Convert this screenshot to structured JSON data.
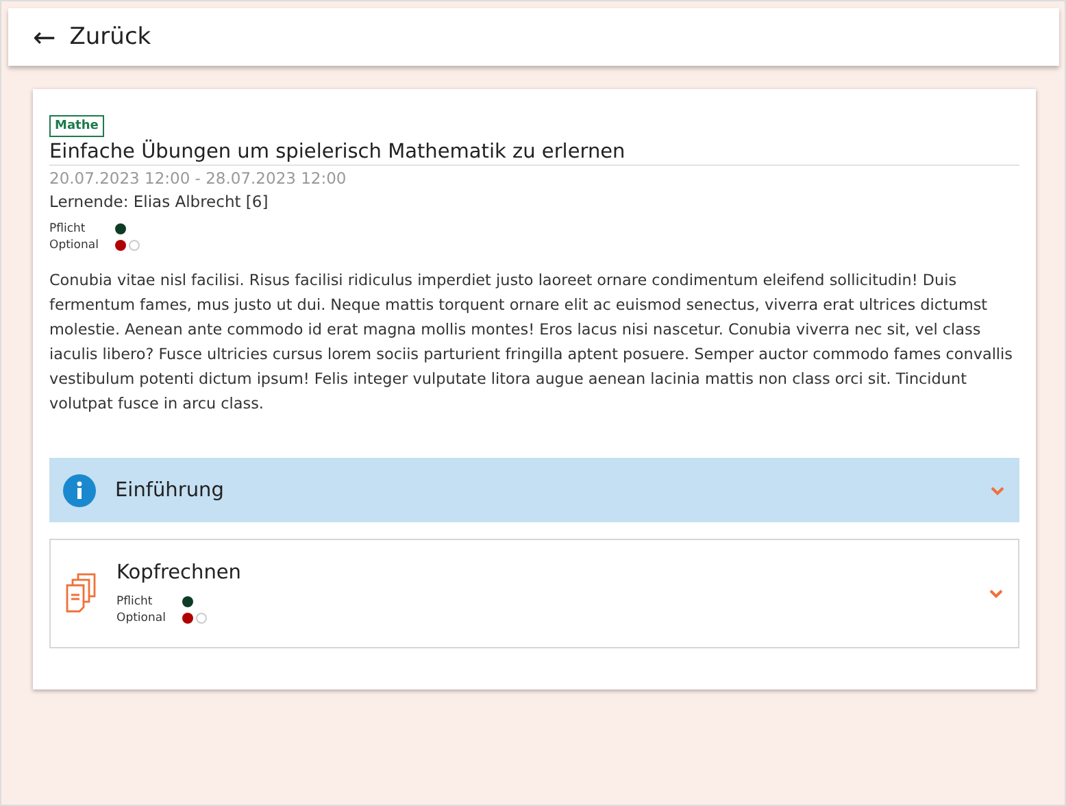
{
  "header": {
    "back_icon": "←",
    "title": "Zurück"
  },
  "task": {
    "tag": "Mathe",
    "title": "Einfache Übungen um spielerisch Mathematik zu erlernen",
    "period": "20.07.2023 12:00 - 28.07.2023 12:00",
    "learner": "Lernende: Elias Albrecht [6]",
    "status": [
      {
        "label": "Pflicht",
        "dots": [
          {
            "filled": true,
            "color": "#0d3b25"
          }
        ]
      },
      {
        "label": "Optional",
        "dots": [
          {
            "filled": true,
            "color": "#b00000"
          },
          {
            "filled": false,
            "color": "#cccccc"
          }
        ]
      }
    ],
    "description": "Conubia vitae nisl facilisi. Risus facilisi ridiculus imperdiet justo laoreet ornare condimentum eleifend sollicitudin! Duis fermentum fames, mus justo ut dui. Neque mattis torquent ornare elit ac euismod senectus, viverra erat ultrices dictumst molestie. Aenean ante commodo id erat magna mollis montes! Eros lacus nisi nascetur. Conubia viverra nec sit, vel class iaculis libero? Fusce ultricies cursus lorem sociis parturient fringilla aptent posuere. Semper auctor commodo fames convallis vestibulum potenti dictum ipsum! Felis integer vulputate litora augue aenean lacinia mattis non class orci sit. Tincidunt volutpat fusce in arcu class."
  },
  "sections": [
    {
      "kind": "info",
      "title": "Einführung",
      "expanded": false
    },
    {
      "kind": "exercise",
      "title": "Kopfrechnen",
      "expanded": false,
      "status": [
        {
          "label": "Pflicht",
          "dots": [
            {
              "filled": true,
              "color": "#0d3b25"
            }
          ]
        },
        {
          "label": "Optional",
          "dots": [
            {
              "filled": true,
              "color": "#b00000"
            },
            {
              "filled": false,
              "color": "#cccccc"
            }
          ]
        }
      ]
    }
  ]
}
